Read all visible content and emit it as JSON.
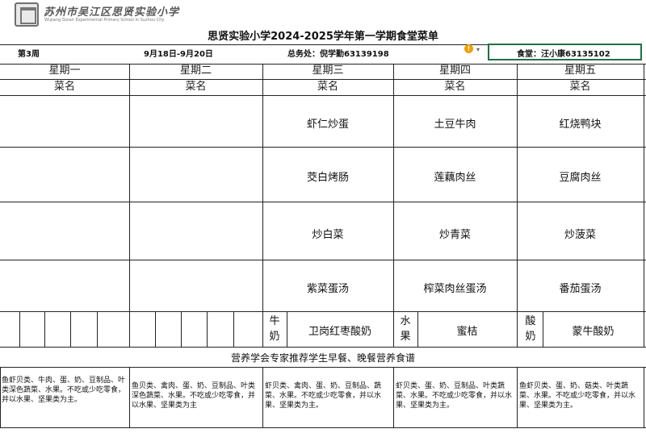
{
  "school_logo": {
    "cn": "苏州市吴江区思贤实验小学",
    "en": "Wujiang Sixian Experimental Primary School in Suzhou City"
  },
  "title": "思贤实验小学2024-2025学年第一学期食堂菜单",
  "week_label": "第3周",
  "date_range": "9月18日-9月20日",
  "general_affairs": "总务处：倪学勤63139198",
  "canteen": "食堂：汪小康63135102",
  "column_header": "菜名",
  "days": [
    {
      "name": "星期一",
      "dishes": [
        "",
        "",
        "",
        ""
      ]
    },
    {
      "name": "星期二",
      "dishes": [
        "",
        "",
        "",
        ""
      ]
    },
    {
      "name": "星期三",
      "dishes": [
        "虾仁炒蛋",
        "茭白烤肠",
        "炒白菜",
        "紫菜蛋汤"
      ]
    },
    {
      "name": "星期四",
      "dishes": [
        "土豆牛肉",
        "莲藕肉丝",
        "炒青菜",
        "榨菜肉丝蛋汤"
      ]
    },
    {
      "name": "星期五",
      "dishes": [
        "红烧鸭块",
        "豆腐肉丝",
        "炒菠菜",
        "番茄蛋汤"
      ]
    }
  ],
  "extras": [
    {
      "label": "牛奶",
      "item": "卫岗红枣酸奶"
    },
    {
      "label": "水果",
      "item": "蜜桔"
    },
    {
      "label": "酸奶",
      "item": "蒙牛酸奶"
    }
  ],
  "nutrition_title": "营养学会专家推荐学生早餐、晚餐营养食谱",
  "nutrition": [
    "鱼虾贝类、牛肉、蛋、奶、豆制品、叶类深色蔬菜、水果。不吃或少吃零食，并以水果、坚果类为主。",
    "鱼贝类、禽肉、蛋、奶、豆制品、叶类深色蔬菜、水果。不吃或少吃零食，并以水果、坚果类为主",
    "虾贝类、禽肉、蛋、奶、豆制品、蔬菜、水果。不吃或少吃零食，并以水果、坚果类为主。",
    "虾贝类、蛋、奶、豆制品、叶类蔬菜、水果。不吃或少吃零食，并以水果、坚果类为主。",
    "鱼虾贝类、蛋、奶、菇类、叶类蔬菜、水果。不吃或少吃零食，并以水果、坚果类为主。"
  ]
}
